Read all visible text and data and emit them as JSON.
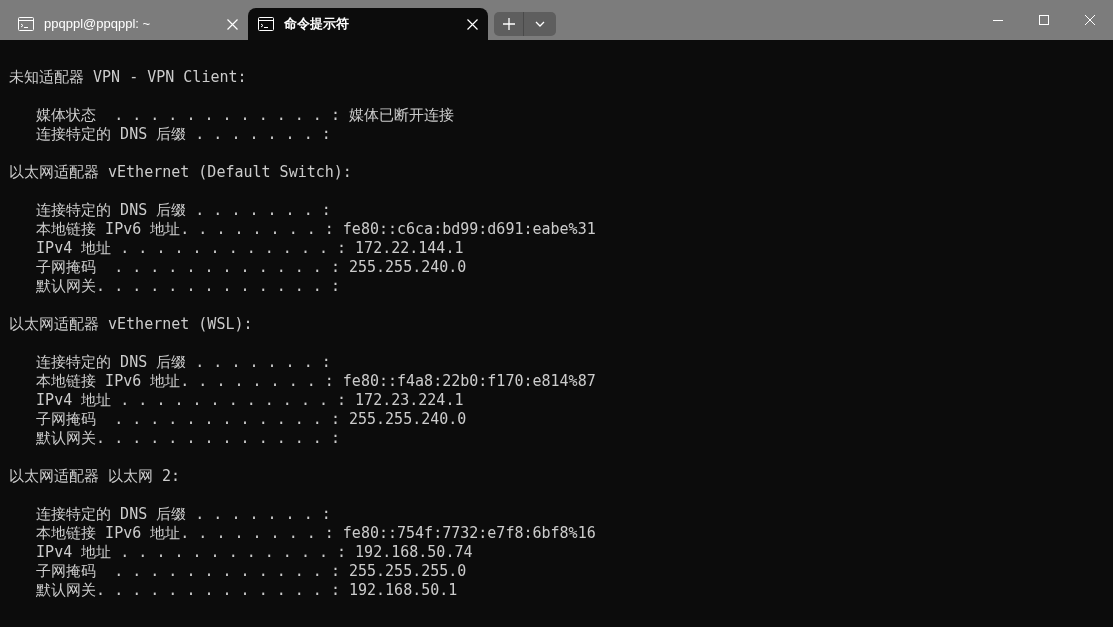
{
  "tabs": [
    {
      "title": "ppqppl@ppqppl: ~",
      "selected": false
    },
    {
      "title": "命令提示符",
      "selected": true
    }
  ],
  "sections": [
    {
      "heading": "未知适配器 VPN - VPN Client:",
      "lines": [
        "   媒体状态  . . . . . . . . . . . . : 媒体已断开连接",
        "   连接特定的 DNS 后缀 . . . . . . . :"
      ]
    },
    {
      "heading": "以太网适配器 vEthernet (Default Switch):",
      "lines": [
        "   连接特定的 DNS 后缀 . . . . . . . :",
        "   本地链接 IPv6 地址. . . . . . . . : fe80::c6ca:bd99:d691:eabe%31",
        "   IPv4 地址 . . . . . . . . . . . . : 172.22.144.1",
        "   子网掩码  . . . . . . . . . . . . : 255.255.240.0",
        "   默认网关. . . . . . . . . . . . . :"
      ]
    },
    {
      "heading": "以太网适配器 vEthernet (WSL):",
      "lines": [
        "   连接特定的 DNS 后缀 . . . . . . . :",
        "   本地链接 IPv6 地址. . . . . . . . : fe80::f4a8:22b0:f170:e814%87",
        "   IPv4 地址 . . . . . . . . . . . . : 172.23.224.1",
        "   子网掩码  . . . . . . . . . . . . : 255.255.240.0",
        "   默认网关. . . . . . . . . . . . . :"
      ]
    },
    {
      "heading": "以太网适配器 以太网 2:",
      "lines": [
        "   连接特定的 DNS 后缀 . . . . . . . :",
        "   本地链接 IPv6 地址. . . . . . . . : fe80::754f:7732:e7f8:6bf8%16",
        "   IPv4 地址 . . . . . . . . . . . . : 192.168.50.74",
        "   子网掩码  . . . . . . . . . . . . : 255.255.255.0",
        "   默认网关. . . . . . . . . . . . . : 192.168.50.1"
      ]
    }
  ]
}
